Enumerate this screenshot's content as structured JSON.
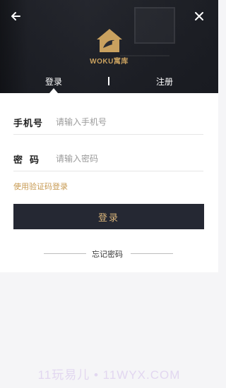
{
  "logo": {
    "text": "WOKU寓库"
  },
  "tabs": {
    "login": "登录",
    "register": "注册"
  },
  "form": {
    "phone_label": "手机号",
    "phone_placeholder": "请输入手机号",
    "password_label": "密码",
    "password_placeholder": "请输入密码",
    "sms_login": "使用验证码登录",
    "submit": "登录",
    "forgot": "忘记密码"
  },
  "watermark": "11玩易儿 • 11WYX.COM",
  "colors": {
    "accent": "#c79a52",
    "button_bg": "#252833",
    "button_text": "#d9b47a"
  },
  "icons": {
    "back": "arrow-left-icon",
    "close": "close-icon",
    "logo": "house-bird-logo"
  }
}
